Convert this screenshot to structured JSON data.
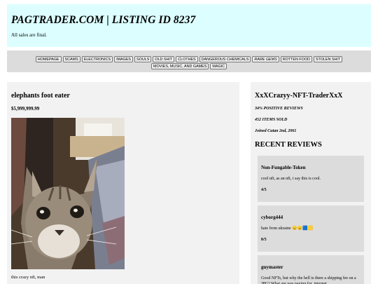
{
  "header": {
    "title": "PAGTRADER.COM | LISTING ID 8237",
    "tagline": "All sales are final."
  },
  "nav": {
    "row1": [
      "HOMEPAGE",
      "SCAMS",
      "ELECTRONICS",
      "IMAGES",
      "SOULS",
      "OLD SHIT",
      "CLOTHES",
      "DANGEROUS CHEMICALS",
      "RARE GEMS",
      "ROTTEN FOOD",
      "STOLEN SHIT"
    ],
    "row2": [
      "MOVIES, MUSIC, AND GAMES",
      "MAGIC"
    ]
  },
  "listing": {
    "title": "elephants foot eater",
    "price": "$5,999,999.99",
    "caption": "this crazy nft, man"
  },
  "seller": {
    "name": "XxXCrazyy-NFT-TraderXxX",
    "positive": "34% POSITIVE REVIEWS",
    "sold": "452 ITEMS SOLD",
    "joined": "Joined Cutan 2nd, 2061",
    "reviews_heading": "RECENT REVIEWS",
    "reviews": [
      {
        "user": "Non-Fungable-Token",
        "text": "cool nft, as an nft, i say this is cool.",
        "score": "4/5"
      },
      {
        "user": "cyborg444",
        "text": "hate from ukraine 😠😠🟦🟨",
        "score": "0/5"
      },
      {
        "user": "guymaster",
        "text": "Good NFTs, but why the hell is there a shipping fee on a JPG? What are you paying for, internet",
        "score": ""
      }
    ]
  },
  "colors": {
    "header_bg": "#dcfeff",
    "nav_bg": "#dcdcdc",
    "panel_bg": "#f2f2f2",
    "review_bg": "#dcdcdc"
  }
}
